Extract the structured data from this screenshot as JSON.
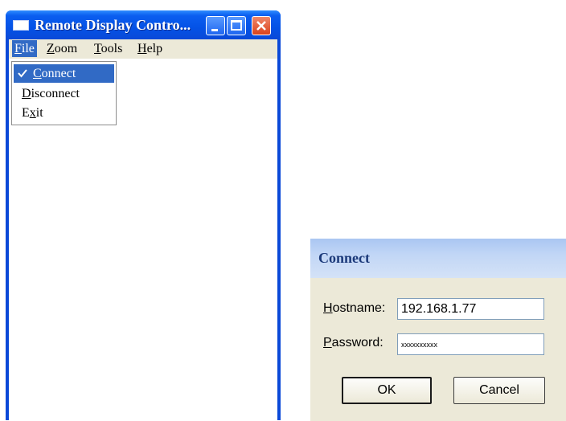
{
  "main_window": {
    "title": "Remote Display Contro...",
    "menu": [
      {
        "key": "F",
        "rest": "ile"
      },
      {
        "key": "Z",
        "rest": "oom"
      },
      {
        "key": "T",
        "rest": "ools"
      },
      {
        "key": "H",
        "rest": "elp"
      }
    ],
    "file_menu": {
      "items": [
        {
          "key": "C",
          "rest": "onnect",
          "checked": true
        },
        {
          "key": "D",
          "rest": "isconnect",
          "checked": false
        },
        {
          "pre": "E",
          "key": "x",
          "rest": "it",
          "checked": false
        }
      ]
    }
  },
  "connect_dialog": {
    "title": "Connect",
    "hostname_label": {
      "key": "H",
      "rest": "ostname:"
    },
    "hostname_value": "192.168.1.77",
    "password_label": {
      "key": "P",
      "rest": "assword:"
    },
    "password_value": "xxxxxxxxxx",
    "ok_label": "OK",
    "cancel_label": "Cancel"
  },
  "colors": {
    "title_blue": "#0452e6",
    "menu_highlight": "#316ac5",
    "dialog_face": "#ece9d8",
    "close_red": "#d9431d"
  },
  "icons": [
    "app-icon",
    "minimize-icon",
    "maximize-icon",
    "close-icon",
    "checkmark-icon"
  ]
}
